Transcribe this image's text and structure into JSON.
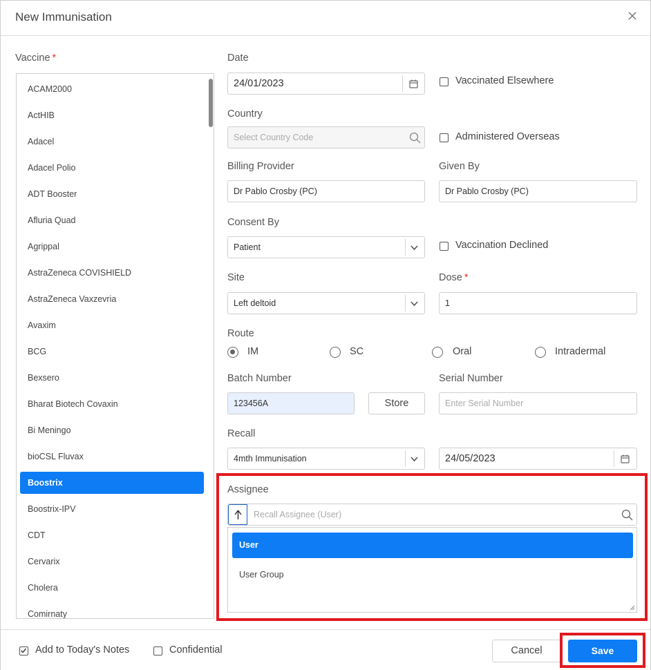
{
  "dialog": {
    "title": "New Immunisation"
  },
  "vaccine": {
    "label": "Vaccine",
    "required": "*",
    "items": [
      "ACAM2000",
      "ActHIB",
      "Adacel",
      "Adacel Polio",
      "ADT Booster",
      "Afluria Quad",
      "Agrippal",
      "AstraZeneca COVISHIELD",
      "AstraZeneca Vaxzevria",
      "Avaxim",
      "BCG",
      "Bexsero",
      "Bharat Biotech Covaxin",
      "Bi Meningo",
      "bioCSL Fluvax",
      "Boostrix",
      "Boostrix-IPV",
      "CDT",
      "Cervarix",
      "Cholera",
      "Comirnaty"
    ],
    "selected": "Boostrix"
  },
  "date": {
    "label": "Date",
    "value": "24/01/2023"
  },
  "vaccinated_elsewhere": {
    "label": "Vaccinated Elsewhere",
    "checked": false
  },
  "country": {
    "label": "Country",
    "placeholder": "Select Country Code"
  },
  "administered_overseas": {
    "label": "Administered Overseas",
    "checked": false
  },
  "billing_provider": {
    "label": "Billing Provider",
    "value": "Dr Pablo Crosby (PC)"
  },
  "given_by": {
    "label": "Given By",
    "value": "Dr Pablo Crosby (PC)"
  },
  "consent_by": {
    "label": "Consent By",
    "value": "Patient"
  },
  "vaccination_declined": {
    "label": "Vaccination Declined",
    "checked": false
  },
  "site": {
    "label": "Site",
    "value": "Left deltoid"
  },
  "dose": {
    "label": "Dose",
    "required": "*",
    "value": "1"
  },
  "route": {
    "label": "Route",
    "options": [
      "IM",
      "SC",
      "Oral",
      "Intradermal"
    ],
    "selected": "IM"
  },
  "batch_number": {
    "label": "Batch Number",
    "value": "123456A",
    "store_label": "Store"
  },
  "serial_number": {
    "label": "Serial Number",
    "placeholder": "Enter Serial Number"
  },
  "recall": {
    "label": "Recall",
    "value": "4mth Immunisation",
    "date": "24/05/2023"
  },
  "assignee": {
    "label": "Assignee",
    "placeholder": "Recall Assignee (User)",
    "options": [
      "User",
      "User Group"
    ],
    "selected": "User"
  },
  "footer": {
    "add_to_notes": {
      "label": "Add to Today's Notes",
      "checked": true
    },
    "confidential": {
      "label": "Confidential",
      "checked": false
    },
    "cancel_label": "Cancel",
    "save_label": "Save"
  },
  "colors": {
    "accent": "#0d7cf5",
    "highlight": "#e0191f",
    "batch_bg": "#e8f0fe"
  }
}
